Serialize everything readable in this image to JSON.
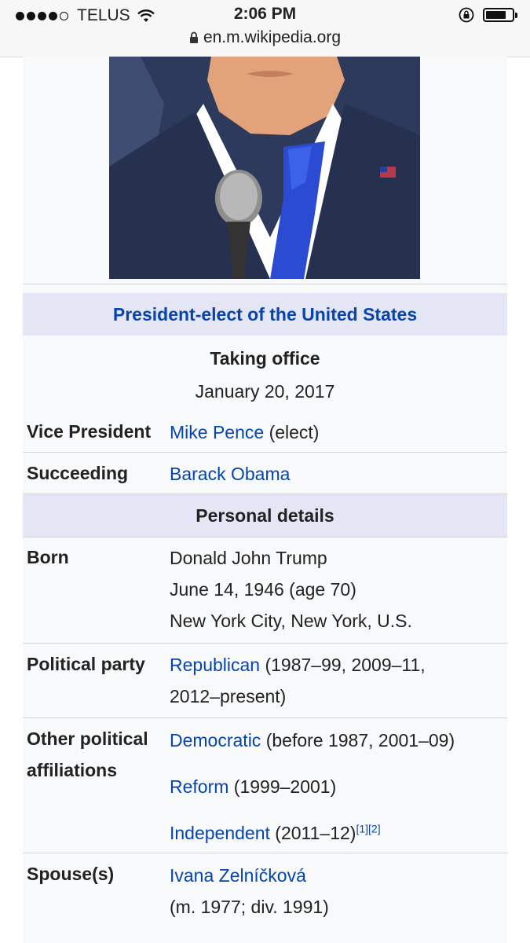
{
  "status": {
    "carrier": "TELUS",
    "time": "2:06 PM",
    "url": "en.m.wikipedia.org"
  },
  "infobox": {
    "office_title": "President-elect of the United States",
    "taking_office_label": "Taking office",
    "taking_office_date": "January 20, 2017",
    "vice_president_label": "Vice President",
    "vice_president_link": "Mike Pence",
    "vice_president_suffix": "(elect)",
    "succeeding_label": "Succeeding",
    "succeeding_link": "Barack Obama",
    "personal_details_heading": "Personal details",
    "born_label": "Born",
    "born_name": "Donald John Trump",
    "born_date": "June 14, 1946 (age 70)",
    "born_place": "New York City, New York, U.S.",
    "party_label": "Political party",
    "party_link": "Republican",
    "party_years_1": "(1987–99, 2009–11,",
    "party_years_2": "2012–present)",
    "other_label_1": "Other political",
    "other_label_2": "affiliations",
    "other_1_link": "Democratic",
    "other_1_years": "(before 1987, 2001–09)",
    "other_2_link": "Reform",
    "other_2_years": "(1999–2001)",
    "other_3_link": "Independent",
    "other_3_years": "(2011–12)",
    "ref_1": "[1]",
    "ref_2": "[2]",
    "spouse_label": "Spouse(s)",
    "spouse_link": "Ivana Zelníčková",
    "spouse_dates": "(m. 1977; div. 1991)"
  }
}
